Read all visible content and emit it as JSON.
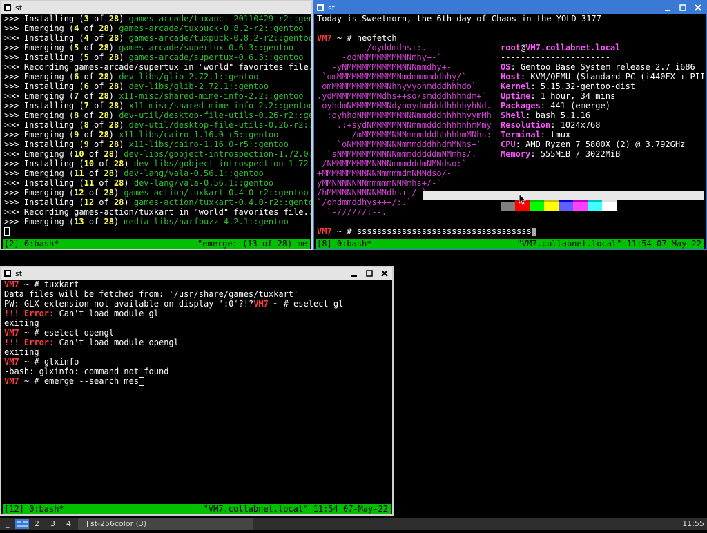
{
  "colors": {
    "status_green": "#00c000",
    "active_border": "#3a7ad6",
    "prompt_red": "#ff3b3b",
    "path_green": "#2bbf2b",
    "count_yellow": "#ffff55",
    "neofetch_magenta": "#d040d0"
  },
  "win1": {
    "title": "st",
    "lines": [
      [
        ">>> Installing (",
        "3",
        " of ",
        "28",
        ") ",
        "games-arcade/tuxanci-20110429-r2::gentoo"
      ],
      [
        ">>> Emerging (",
        "4",
        " of ",
        "28",
        ") ",
        "games-arcade/tuxpuck-0.8.2-r2::gentoo"
      ],
      [
        ">>> Installing (",
        "4",
        " of ",
        "28",
        ") ",
        "games-arcade/tuxpuck-0.8.2-r2::gentoo"
      ],
      [
        ">>> Emerging (",
        "5",
        " of ",
        "28",
        ") ",
        "games-arcade/supertux-0.6.3::gentoo"
      ],
      [
        ">>> Installing (",
        "5",
        " of ",
        "28",
        ") ",
        "games-arcade/supertux-0.6.3::gentoo"
      ],
      [
        ">>> Recording games-arcade/supertux in \"world\" favorites file...",
        "",
        "",
        "",
        "",
        ""
      ],
      [
        ">>> Emerging (",
        "6",
        " of ",
        "28",
        ") ",
        "dev-libs/glib-2.72.1::gentoo"
      ],
      [
        ">>> Installing (",
        "6",
        " of ",
        "28",
        ") ",
        "dev-libs/glib-2.72.1::gentoo"
      ],
      [
        ">>> Emerging (",
        "7",
        " of ",
        "28",
        ") ",
        "x11-misc/shared-mime-info-2.2::gentoo"
      ],
      [
        ">>> Installing (",
        "7",
        " of ",
        "28",
        ") ",
        "x11-misc/shared-mime-info-2.2::gentoo"
      ],
      [
        ">>> Emerging (",
        "8",
        " of ",
        "28",
        ") ",
        "dev-util/desktop-file-utils-0.26-r2::gent"
      ],
      [
        ">>> Installing (",
        "8",
        " of ",
        "28",
        ") ",
        "dev-util/desktop-file-utils-0.26-r2::ge"
      ],
      [
        ">>> Emerging (",
        "9",
        " of ",
        "28",
        ") ",
        "x11-libs/cairo-1.16.0-r5::gentoo"
      ],
      [
        ">>> Installing (",
        "9",
        " of ",
        "28",
        ") ",
        "x11-libs/cairo-1.16.0-r5::gentoo"
      ],
      [
        ">>> Emerging (",
        "10",
        " of ",
        "28",
        ") ",
        "dev-libs/gobject-introspection-1.72.0::g"
      ],
      [
        ">>> Installing (",
        "10",
        " of ",
        "28",
        ") ",
        "dev-libs/gobject-introspection-1.72.0:"
      ],
      [
        ">>> Emerging (",
        "11",
        " of ",
        "28",
        ") ",
        "dev-lang/vala-0.56.1::gentoo"
      ],
      [
        ">>> Installing (",
        "11",
        " of ",
        "28",
        ") ",
        "dev-lang/vala-0.56.1::gentoo"
      ],
      [
        ">>> Emerging (",
        "12",
        " of ",
        "28",
        ") ",
        "games-action/tuxkart-0.4.0-r2::gentoo"
      ],
      [
        ">>> Installing (",
        "12",
        " of ",
        "28",
        ") ",
        "games-action/tuxkart-0.4.0-r2::gentoo"
      ],
      [
        ">>> Recording games-action/tuxkart in \"world\" favorites file...",
        "",
        "",
        "",
        "",
        ""
      ],
      [
        ">>> Emerging (",
        "13",
        " of ",
        "28",
        ") ",
        "media-libs/harfbuzz-4.2.1::gentoo"
      ]
    ],
    "status_left": "[2] 0:bash*",
    "status_right": "\"emerge: (13 of 28) me"
  },
  "win2": {
    "title": "st",
    "date_line": "Today is Sweetmorn, the 6th day of Chaos in the YOLD 3177",
    "prompt_host": "VM7",
    "prompt_rest": " ~ # ",
    "cmd1": "neofetch",
    "logo": [
      "         -/oyddmdhs+:.",
      "     -odNMMMMMMMMNNmhy+-`",
      "   -yNMMMMMMMMMMMNNNmmdhy+-",
      " `omMMMMMMMMMMMMNmdmmmmddhhy/`",
      " omMMMMMMMMMMMNhhyyyohmdddhhhdo`",
      ".ydMMMMMMMMMMdhs++so/smdddhhhhdm+`",
      " oyhdmNMMMMMMMNdyooydmddddhhhhyhNd.",
      "  :oyhhdNNMMMMMMMNNNmmdddhhhhhyymMh",
      "    .:+sydNMMMMMNNNmmmdddhhhhhhmMmy",
      "       /mMMMMMMNNNmmmdddhhhhhmMNhs:",
      "    `oNMMMMMMMNNNmmmdddhhdmMNhs+`",
      "  `sNMMMMMMMMNNNmmmdddddmNMmhs/.",
      " /NMMMMMMMMNNNNmmmdddmNMNdso:`",
      "+MMMMMMMNNNNNmmmmdmNMNdso/-",
      "yMMNNNNNNNmmmmmNNMmhs+/-`",
      "/hMMNNNNNNNNMNdhs++/-`",
      "`/ohdmmddhys+++/:.`",
      "  `-//////:--."
    ],
    "user": "root",
    "at": "@",
    "host": "VM7.collabnet.local",
    "sep": "----------------------",
    "info": [
      {
        "k": "OS",
        "v": "Gentoo Base System release 2.7 i686"
      },
      {
        "k": "Host",
        "v": "KVM/QEMU (Standard PC (i440FX + PII"
      },
      {
        "k": "Kernel",
        "v": "5.15.32-gentoo-dist"
      },
      {
        "k": "Uptime",
        "v": "1 hour, 34 mins"
      },
      {
        "k": "Packages",
        "v": "441 (emerge)"
      },
      {
        "k": "Shell",
        "v": "bash 5.1.16"
      },
      {
        "k": "Resolution",
        "v": "1024x768"
      },
      {
        "k": "Terminal",
        "v": "tmux"
      },
      {
        "k": "CPU",
        "v": "AMD Ryzen 7 5800X (2) @ 3.792GHz"
      },
      {
        "k": "Memory",
        "v": "555MiB / 3022MiB"
      }
    ],
    "palette_top": [
      "#000000",
      "#e00000",
      "#00c000",
      "#c0c000",
      "#0000e0",
      "#c000c0",
      "#00c0c0",
      "#e0e0e0"
    ],
    "palette_bottom": [
      "#808080",
      "#ff0000",
      "#00ff00",
      "#ffff00",
      "#6060ff",
      "#ff40ff",
      "#40ffff",
      "#ffffff"
    ],
    "cmd2": "sssssssssssssssssssssssssssssssssss",
    "status_left": "[8] 0:bash*",
    "status_right": "\"VM7.collabnet.local\" 11:54 07-May-22"
  },
  "win3": {
    "title": "st",
    "prompt_host": "VM7",
    "prompt_rest": " ~ # ",
    "cmd_tuxkart": "tuxkart",
    "line_data": "Data files will be fetched from: '/usr/share/games/tuxkart'",
    "line_pw": "PW: GLX extension not available on display ':0'?!?",
    "cmd_eselect_gl": "eselect gl",
    "err_mark": "!!! ",
    "err_word": "Error:",
    "err_gl": " Can't load module gl",
    "exiting": "exiting",
    "cmd_eselect_opengl": "eselect opengl",
    "err_opengl": " Can't load module opengl",
    "cmd_glxinfo": "glxinfo",
    "glxinfo_err": "-bash: glxinfo: command not found",
    "cmd_emerge": "emerge --search mes",
    "status_left": "[12] 0:bash*",
    "status_right": "\"VM7.collabnet.local\" 11:54 07-May-22"
  },
  "taskbar": {
    "ws_marker": "_",
    "workspaces": [
      "2",
      "3",
      "4"
    ],
    "task_label": "st-256color (3)",
    "clock": "11:55"
  }
}
